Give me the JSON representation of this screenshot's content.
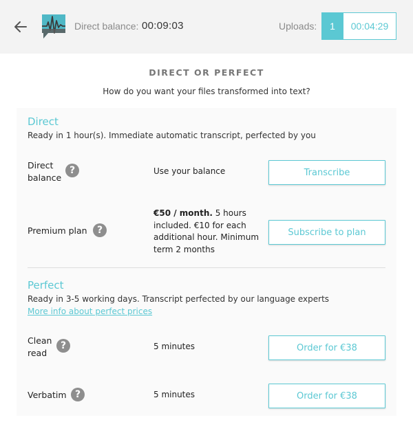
{
  "header": {
    "direct_balance_label": "Direct balance:",
    "direct_balance_value": "00:09:03",
    "uploads_label": "Uploads:",
    "uploads_count": "1",
    "uploads_time": "00:04:29"
  },
  "colors": {
    "accent": "#5bc8d3",
    "help_icon": "#8e8e8e"
  },
  "icons": {
    "back": "arrow-left-icon",
    "logo": "waveform-speech-logo",
    "help": "question-mark-icon"
  },
  "page": {
    "title": "DIRECT OR PERFECT",
    "subtitle": "How do you want your files transformed into text?"
  },
  "direct": {
    "title": "Direct",
    "description": "Ready in 1 hour(s). Immediate automatic transcript, perfected by you",
    "rows": [
      {
        "label_line1": "Direct",
        "label_line2": "balance",
        "description": "Use your balance",
        "button": "Transcribe"
      },
      {
        "label": "Premium plan",
        "description_bold": "€50 / month.",
        "description_line1_rest": " 5 hours",
        "description_line2": "included. €10 for each",
        "description_line3": "additional hour. Minimum",
        "description_line4": "term 2 months",
        "button": "Subscribe to plan"
      }
    ]
  },
  "perfect": {
    "title": "Perfect",
    "description": "Ready in 3-5 working days. Transcript perfected by our language experts",
    "link": "More info about perfect prices",
    "rows": [
      {
        "label_line1": "Clean",
        "label_line2": "read",
        "description": "5 minutes",
        "button": "Order for €38"
      },
      {
        "label": "Verbatim",
        "description": "5 minutes",
        "button": "Order for €38"
      }
    ]
  }
}
